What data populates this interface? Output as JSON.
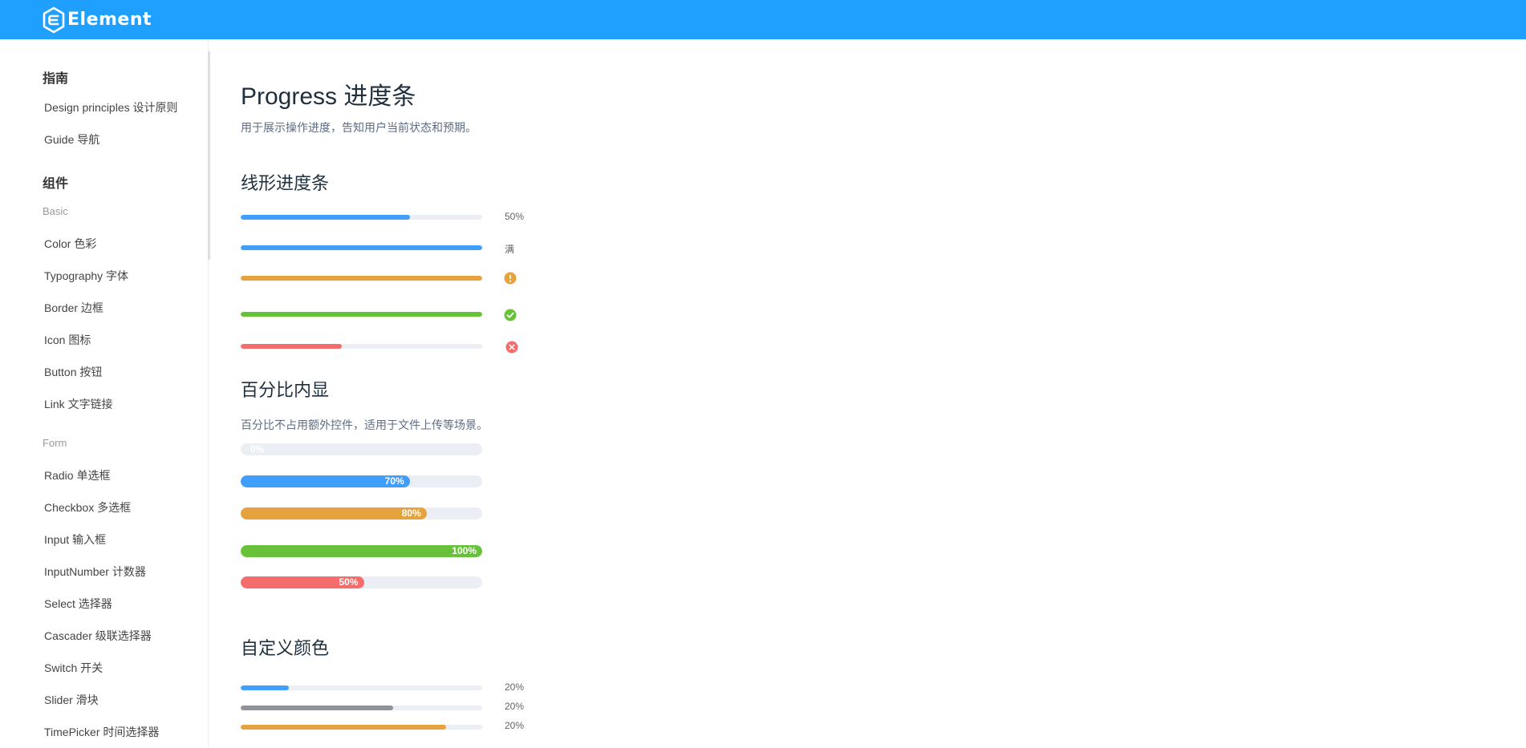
{
  "header": {
    "logo_text": "Element",
    "color": "#1fa0ff"
  },
  "sidebar": {
    "sections": [
      {
        "title": "指南"
      },
      {
        "title": "组件"
      }
    ],
    "guide_items": [
      {
        "label": "Design principles  设计原则"
      },
      {
        "label": "Guide 导航"
      }
    ],
    "groups": [
      {
        "title": "Basic"
      },
      {
        "title": "Form"
      }
    ],
    "basic_items": [
      {
        "label": "Color 色彩"
      },
      {
        "label": "Typography 字体"
      },
      {
        "label": "Border 边框"
      },
      {
        "label": "Icon 图标"
      },
      {
        "label": "Button 按钮"
      },
      {
        "label": "Link 文字链接"
      }
    ],
    "form_items": [
      {
        "label": "Radio 单选框"
      },
      {
        "label": "Checkbox 多选框"
      },
      {
        "label": "Input 输入框"
      },
      {
        "label": "InputNumber 计数器"
      },
      {
        "label": "Select 选择器"
      },
      {
        "label": "Cascader 级联选择器"
      },
      {
        "label": "Switch 开关"
      },
      {
        "label": "Slider 滑块"
      },
      {
        "label": "TimePicker 时间选择器"
      }
    ]
  },
  "main": {
    "title": "Progress 进度条",
    "description": "用于展示操作进度，告知用户当前状态和预期。",
    "linear": {
      "title": "线形进度条",
      "bars": [
        {
          "percentage": 70,
          "color": "#409eff",
          "label": "50%",
          "status": "text"
        },
        {
          "percentage": 100,
          "color": "#409eff",
          "label": "满",
          "status": "text"
        },
        {
          "percentage": 100,
          "color": "#e6a23c",
          "label": "",
          "status": "warning",
          "icon": "warning-icon"
        },
        {
          "percentage": 100,
          "color": "#67c23a",
          "label": "",
          "status": "success",
          "icon": "success-check-icon"
        },
        {
          "percentage": 42,
          "color": "#f56c6c",
          "label": "",
          "status": "exception",
          "icon": "exception-close-icon"
        }
      ]
    },
    "inside": {
      "title": "百分比内显",
      "description": "百分比不占用额外控件，适用于文件上传等场景。",
      "bars": [
        {
          "percentage": 0,
          "color": "#409eff",
          "label": "0%"
        },
        {
          "percentage": 70,
          "color": "#409eff",
          "label": "70%"
        },
        {
          "percentage": 77,
          "color": "#e6a23c",
          "label": "80%"
        },
        {
          "percentage": 100,
          "color": "#67c23a",
          "label": "100%"
        },
        {
          "percentage": 51,
          "color": "#f56c6c",
          "label": "50%"
        }
      ]
    },
    "custom": {
      "title": "自定义颜色",
      "bars": [
        {
          "percentage": 20,
          "color": "#409eff",
          "label": "20%"
        },
        {
          "percentage": 63,
          "color": "#909399",
          "label": "20%"
        },
        {
          "percentage": 85,
          "color": "#e6a23c",
          "label": "20%"
        }
      ]
    }
  }
}
